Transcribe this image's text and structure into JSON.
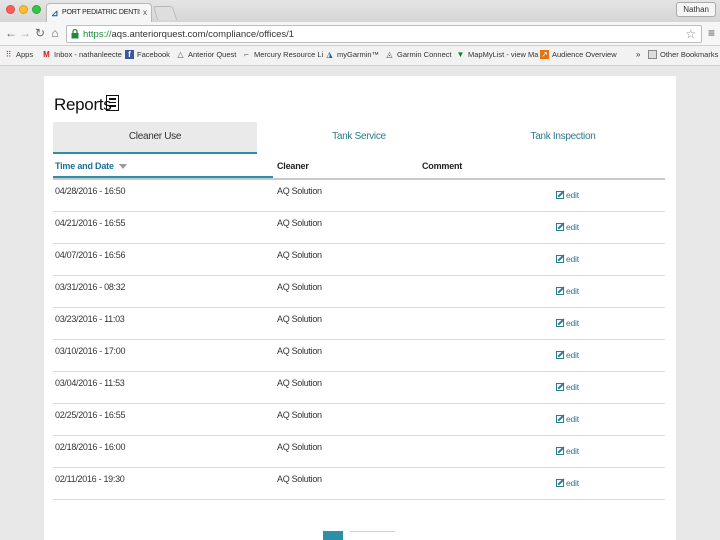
{
  "browser": {
    "tab_title": "PORT PEDIATRIC DENTISTR",
    "tab_close": "x",
    "profile_name": "Nathan",
    "url_scheme": "https://",
    "url_rest": "aqs.anteriorquest.com/compliance/offices/1",
    "bookmarks": [
      {
        "label": "Apps",
        "icon": "apps-grid-icon"
      },
      {
        "label": "Inbox - nathanleecte",
        "icon": "gmail-icon"
      },
      {
        "label": "Facebook",
        "icon": "facebook-icon"
      },
      {
        "label": "Anterior Quest",
        "icon": "anterior-quest-icon"
      },
      {
        "label": "Mercury Resource Li",
        "icon": "mercury-icon"
      },
      {
        "label": "myGarmin™",
        "icon": "garmin-icon"
      },
      {
        "label": "Garmin Connect",
        "icon": "garmin-connect-icon"
      },
      {
        "label": "MapMyList - view Ma",
        "icon": "mapmylist-icon"
      },
      {
        "label": "Audience Overview",
        "icon": "analytics-icon"
      }
    ],
    "bookmarks_overflow": "»",
    "other_bookmarks": "Other Bookmarks"
  },
  "page": {
    "title": "Reports",
    "tabs": [
      {
        "label": "Cleaner Use",
        "active": true
      },
      {
        "label": "Tank Service",
        "active": false
      },
      {
        "label": "Tank Inspection",
        "active": false
      }
    ],
    "columns": {
      "time": "Time and Date",
      "cleaner": "Cleaner",
      "comment": "Comment"
    },
    "edit_label": "edit",
    "rows": [
      {
        "date": "04/28/2016 - 16:50",
        "cleaner": "AQ Solution",
        "comment": ""
      },
      {
        "date": "04/21/2016 - 16:55",
        "cleaner": "AQ Solution",
        "comment": ""
      },
      {
        "date": "04/07/2016 - 16:56",
        "cleaner": "AQ Solution",
        "comment": ""
      },
      {
        "date": "03/31/2016 - 08:32",
        "cleaner": "AQ Solution",
        "comment": ""
      },
      {
        "date": "03/23/2016 - 11:03",
        "cleaner": "AQ Solution",
        "comment": ""
      },
      {
        "date": "03/10/2016 - 17:00",
        "cleaner": "AQ Solution",
        "comment": ""
      },
      {
        "date": "03/04/2016 - 11:53",
        "cleaner": "AQ Solution",
        "comment": ""
      },
      {
        "date": "02/25/2016 - 16:55",
        "cleaner": "AQ Solution",
        "comment": ""
      },
      {
        "date": "02/18/2016 - 16:00",
        "cleaner": "AQ Solution",
        "comment": ""
      },
      {
        "date": "02/11/2016 - 19:30",
        "cleaner": "AQ Solution",
        "comment": ""
      }
    ]
  },
  "colors": {
    "accent": "#2b8fa6",
    "link": "#2c7a8c"
  }
}
